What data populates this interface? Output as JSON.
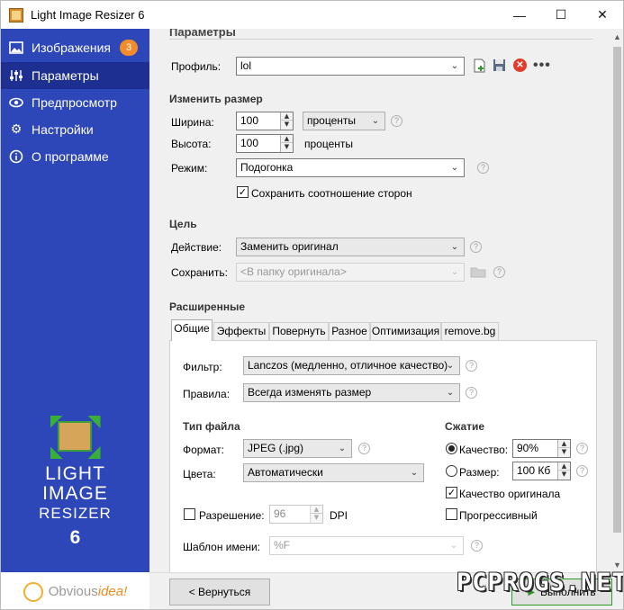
{
  "window": {
    "title": "Light Image Resizer 6",
    "minimize": "—",
    "maximize": "☐",
    "close": "✕"
  },
  "sidebar": {
    "items": [
      {
        "label": "Изображения",
        "icon": "images-icon",
        "badge": "3"
      },
      {
        "label": "Параметры",
        "icon": "sliders-icon"
      },
      {
        "label": "Предпросмотр",
        "icon": "eye-icon"
      },
      {
        "label": "Настройки",
        "icon": "gear-icon"
      },
      {
        "label": "О программе",
        "icon": "info-icon"
      }
    ],
    "logo": {
      "line1": "LIGHT",
      "line2": "IMAGE",
      "line3": "RESIZER",
      "version": "6"
    },
    "brand": {
      "obvious": "Obvious",
      "idea": "idea!"
    }
  },
  "main": {
    "header": "Параметры",
    "profile": {
      "label": "Профиль:",
      "value": "lol"
    },
    "resize": {
      "title": "Изменить размер",
      "width_label": "Ширина:",
      "width_value": "100",
      "width_unit": "проценты",
      "height_label": "Высота:",
      "height_value": "100",
      "height_unit": "проценты",
      "mode_label": "Режим:",
      "mode_value": "Подогонка",
      "keep_ratio": "Сохранить соотношение сторон"
    },
    "target": {
      "title": "Цель",
      "action_label": "Действие:",
      "action_value": "Заменить оригинал",
      "save_label": "Сохранить:",
      "save_value": "<В папку оригинала>"
    },
    "advanced": {
      "title": "Расширенные",
      "tabs": [
        "Общие",
        "Эффекты",
        "Повернуть",
        "Разное",
        "Оптимизация",
        "remove.bg"
      ],
      "filter_label": "Фильтр:",
      "filter_value": "Lanczos  (медленно, отличное качество)",
      "rules_label": "Правила:",
      "rules_value": "Всегда изменять размер",
      "filetype_title": "Тип файла",
      "format_label": "Формат:",
      "format_value": "JPEG (.jpg)",
      "colors_label": "Цвета:",
      "colors_value": "Автоматически",
      "compression_title": "Сжатие",
      "quality_label": "Качество:",
      "quality_value": "90%",
      "size_label": "Размер:",
      "size_value": "100 Кб",
      "orig_quality": "Качество оригинала",
      "progressive": "Прогрессивный",
      "resolution_label": "Разрешение:",
      "resolution_value": "96",
      "dpi": "DPI",
      "name_template_label": "Шаблон имени:",
      "name_template_value": "%F"
    }
  },
  "footer": {
    "back": "< Вернуться",
    "run": "Выполнить"
  },
  "watermark": "PCPROGS.NET",
  "colors": {
    "sidebar": "#2e47b8",
    "sidebar_selected": "#1d3092",
    "badge": "#f28b2a",
    "delete": "#e03c2c"
  }
}
